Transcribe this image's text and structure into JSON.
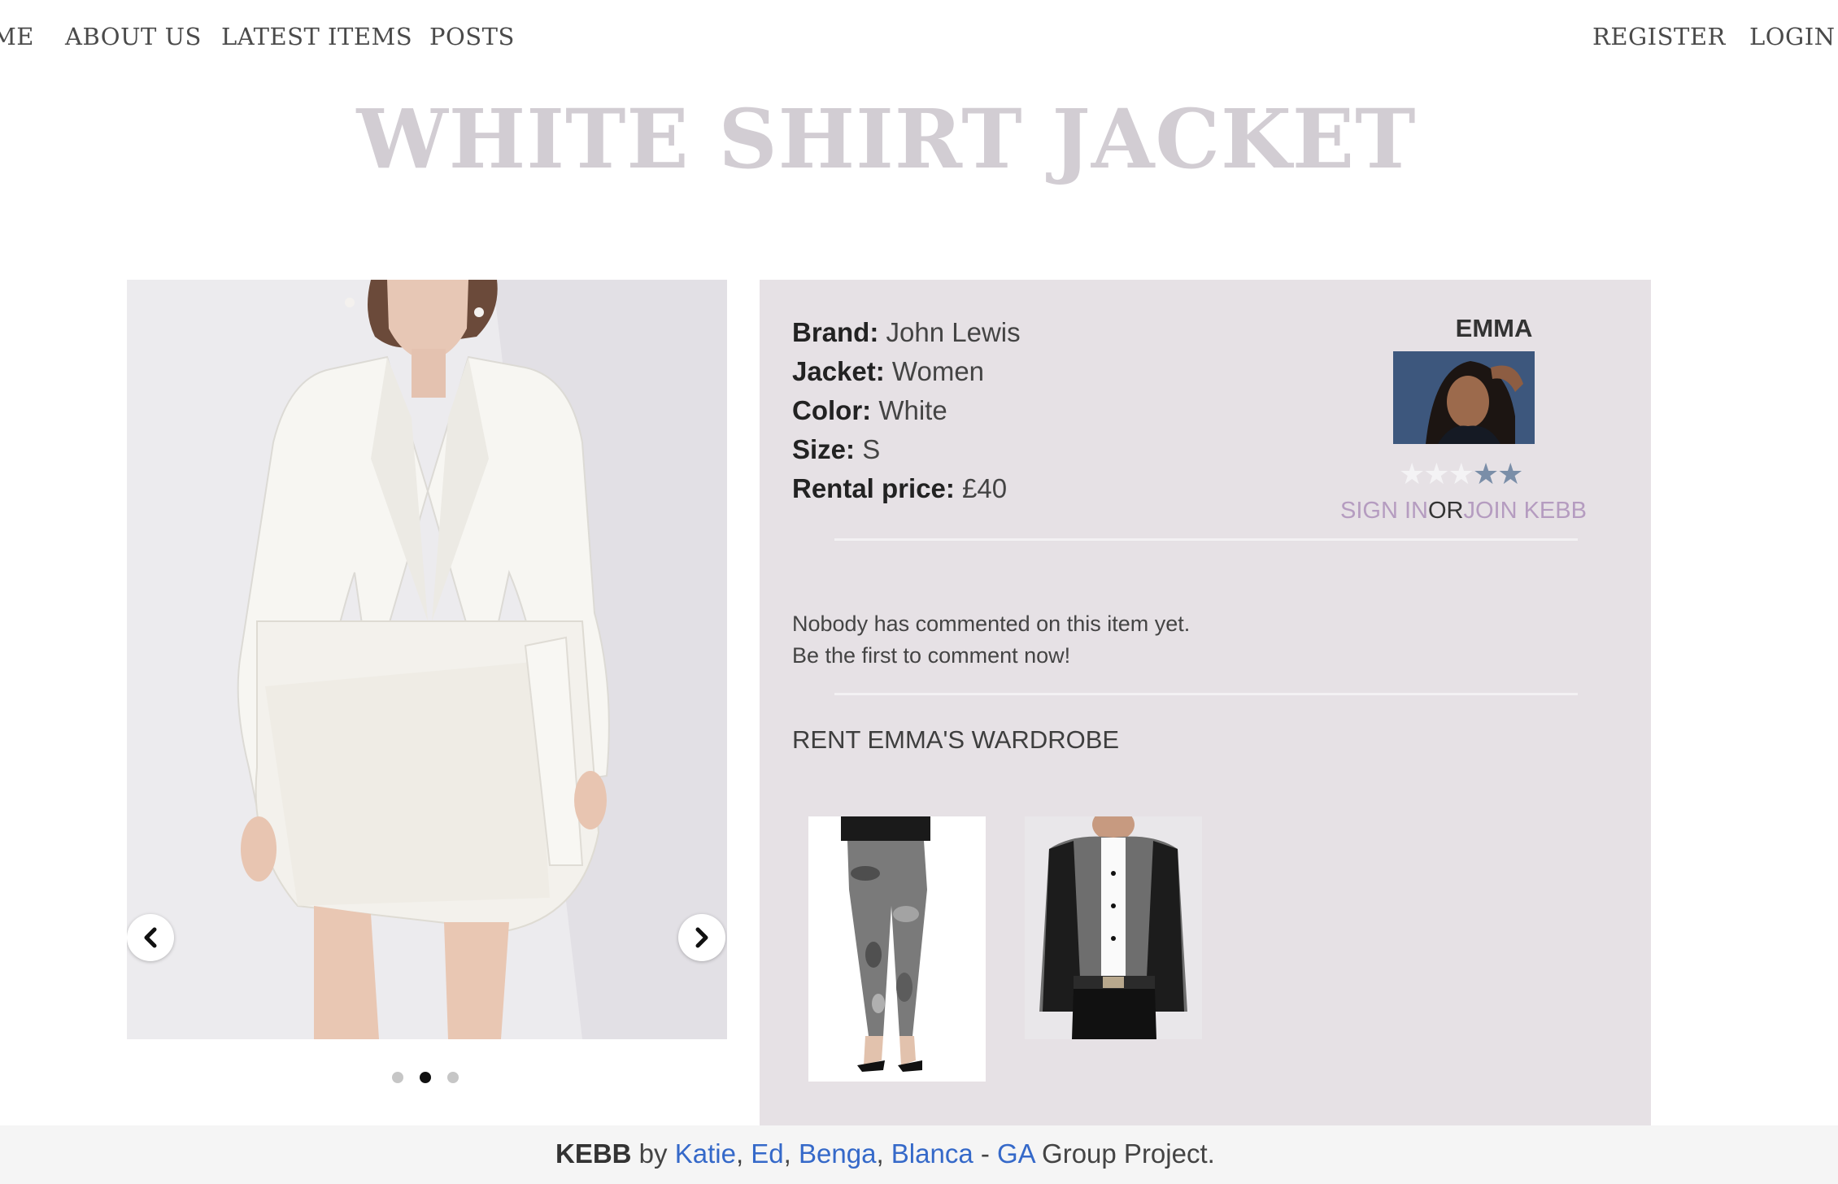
{
  "nav": {
    "home": "HOME",
    "about": "ABOUT US",
    "latest": "LATEST ITEMS",
    "posts": "POSTS",
    "register": "REGISTER",
    "login": "LOGIN"
  },
  "page": {
    "title": "WHITE SHIRT JACKET"
  },
  "carousel": {
    "current_slide": 2,
    "total_slides": 3
  },
  "details": {
    "brand_label": "Brand:",
    "brand_value": "John Lewis",
    "jacket_label": "Jacket:",
    "jacket_value": "Women",
    "color_label": "Color:",
    "color_value": "White",
    "size_label": "Size:",
    "size_value": "S",
    "price_label": "Rental price:",
    "price_value": "£40"
  },
  "owner": {
    "name": "EMMA",
    "rating": {
      "filled": 2,
      "out_of": 5
    },
    "sign_in": "SIGN IN",
    "or": "OR",
    "join": "JOIN KEBB"
  },
  "comments": {
    "line1": "Nobody has commented on this item yet.",
    "line2": "Be the first to comment now!"
  },
  "wardrobe": {
    "title": "RENT EMMA'S WARDROBE"
  },
  "footer": {
    "brand": "KEBB",
    "by": " by ",
    "author1": "Katie",
    "sep1": ", ",
    "author2": "Ed",
    "sep2": ", ",
    "author3": "Benga",
    "sep3": ", ",
    "author4": "Blanca",
    "dash": " - ",
    "ga": "GA",
    "suffix": " Group Project."
  },
  "colors": {
    "title": "#d2cdd3",
    "panel_bg": "#e6e1e5",
    "link_accent": "#b59cc0",
    "footer_link": "#3569c9",
    "star_on": "#7a8ea8"
  },
  "icons": [
    "chevron-left-icon",
    "chevron-right-icon",
    "star-icon"
  ]
}
